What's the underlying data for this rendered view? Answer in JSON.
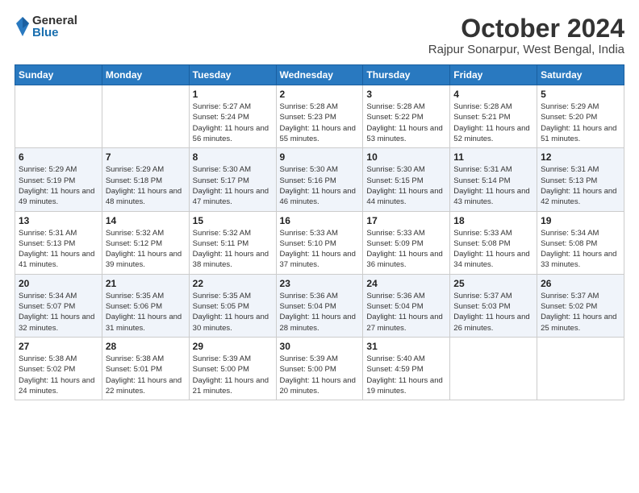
{
  "logo": {
    "general": "General",
    "blue": "Blue"
  },
  "title": "October 2024",
  "location": "Rajpur Sonarpur, West Bengal, India",
  "headers": [
    "Sunday",
    "Monday",
    "Tuesday",
    "Wednesday",
    "Thursday",
    "Friday",
    "Saturday"
  ],
  "weeks": [
    [
      {
        "day": "",
        "sunrise": "",
        "sunset": "",
        "daylight": ""
      },
      {
        "day": "",
        "sunrise": "",
        "sunset": "",
        "daylight": ""
      },
      {
        "day": "1",
        "sunrise": "Sunrise: 5:27 AM",
        "sunset": "Sunset: 5:24 PM",
        "daylight": "Daylight: 11 hours and 56 minutes."
      },
      {
        "day": "2",
        "sunrise": "Sunrise: 5:28 AM",
        "sunset": "Sunset: 5:23 PM",
        "daylight": "Daylight: 11 hours and 55 minutes."
      },
      {
        "day": "3",
        "sunrise": "Sunrise: 5:28 AM",
        "sunset": "Sunset: 5:22 PM",
        "daylight": "Daylight: 11 hours and 53 minutes."
      },
      {
        "day": "4",
        "sunrise": "Sunrise: 5:28 AM",
        "sunset": "Sunset: 5:21 PM",
        "daylight": "Daylight: 11 hours and 52 minutes."
      },
      {
        "day": "5",
        "sunrise": "Sunrise: 5:29 AM",
        "sunset": "Sunset: 5:20 PM",
        "daylight": "Daylight: 11 hours and 51 minutes."
      }
    ],
    [
      {
        "day": "6",
        "sunrise": "Sunrise: 5:29 AM",
        "sunset": "Sunset: 5:19 PM",
        "daylight": "Daylight: 11 hours and 49 minutes."
      },
      {
        "day": "7",
        "sunrise": "Sunrise: 5:29 AM",
        "sunset": "Sunset: 5:18 PM",
        "daylight": "Daylight: 11 hours and 48 minutes."
      },
      {
        "day": "8",
        "sunrise": "Sunrise: 5:30 AM",
        "sunset": "Sunset: 5:17 PM",
        "daylight": "Daylight: 11 hours and 47 minutes."
      },
      {
        "day": "9",
        "sunrise": "Sunrise: 5:30 AM",
        "sunset": "Sunset: 5:16 PM",
        "daylight": "Daylight: 11 hours and 46 minutes."
      },
      {
        "day": "10",
        "sunrise": "Sunrise: 5:30 AM",
        "sunset": "Sunset: 5:15 PM",
        "daylight": "Daylight: 11 hours and 44 minutes."
      },
      {
        "day": "11",
        "sunrise": "Sunrise: 5:31 AM",
        "sunset": "Sunset: 5:14 PM",
        "daylight": "Daylight: 11 hours and 43 minutes."
      },
      {
        "day": "12",
        "sunrise": "Sunrise: 5:31 AM",
        "sunset": "Sunset: 5:13 PM",
        "daylight": "Daylight: 11 hours and 42 minutes."
      }
    ],
    [
      {
        "day": "13",
        "sunrise": "Sunrise: 5:31 AM",
        "sunset": "Sunset: 5:13 PM",
        "daylight": "Daylight: 11 hours and 41 minutes."
      },
      {
        "day": "14",
        "sunrise": "Sunrise: 5:32 AM",
        "sunset": "Sunset: 5:12 PM",
        "daylight": "Daylight: 11 hours and 39 minutes."
      },
      {
        "day": "15",
        "sunrise": "Sunrise: 5:32 AM",
        "sunset": "Sunset: 5:11 PM",
        "daylight": "Daylight: 11 hours and 38 minutes."
      },
      {
        "day": "16",
        "sunrise": "Sunrise: 5:33 AM",
        "sunset": "Sunset: 5:10 PM",
        "daylight": "Daylight: 11 hours and 37 minutes."
      },
      {
        "day": "17",
        "sunrise": "Sunrise: 5:33 AM",
        "sunset": "Sunset: 5:09 PM",
        "daylight": "Daylight: 11 hours and 36 minutes."
      },
      {
        "day": "18",
        "sunrise": "Sunrise: 5:33 AM",
        "sunset": "Sunset: 5:08 PM",
        "daylight": "Daylight: 11 hours and 34 minutes."
      },
      {
        "day": "19",
        "sunrise": "Sunrise: 5:34 AM",
        "sunset": "Sunset: 5:08 PM",
        "daylight": "Daylight: 11 hours and 33 minutes."
      }
    ],
    [
      {
        "day": "20",
        "sunrise": "Sunrise: 5:34 AM",
        "sunset": "Sunset: 5:07 PM",
        "daylight": "Daylight: 11 hours and 32 minutes."
      },
      {
        "day": "21",
        "sunrise": "Sunrise: 5:35 AM",
        "sunset": "Sunset: 5:06 PM",
        "daylight": "Daylight: 11 hours and 31 minutes."
      },
      {
        "day": "22",
        "sunrise": "Sunrise: 5:35 AM",
        "sunset": "Sunset: 5:05 PM",
        "daylight": "Daylight: 11 hours and 30 minutes."
      },
      {
        "day": "23",
        "sunrise": "Sunrise: 5:36 AM",
        "sunset": "Sunset: 5:04 PM",
        "daylight": "Daylight: 11 hours and 28 minutes."
      },
      {
        "day": "24",
        "sunrise": "Sunrise: 5:36 AM",
        "sunset": "Sunset: 5:04 PM",
        "daylight": "Daylight: 11 hours and 27 minutes."
      },
      {
        "day": "25",
        "sunrise": "Sunrise: 5:37 AM",
        "sunset": "Sunset: 5:03 PM",
        "daylight": "Daylight: 11 hours and 26 minutes."
      },
      {
        "day": "26",
        "sunrise": "Sunrise: 5:37 AM",
        "sunset": "Sunset: 5:02 PM",
        "daylight": "Daylight: 11 hours and 25 minutes."
      }
    ],
    [
      {
        "day": "27",
        "sunrise": "Sunrise: 5:38 AM",
        "sunset": "Sunset: 5:02 PM",
        "daylight": "Daylight: 11 hours and 24 minutes."
      },
      {
        "day": "28",
        "sunrise": "Sunrise: 5:38 AM",
        "sunset": "Sunset: 5:01 PM",
        "daylight": "Daylight: 11 hours and 22 minutes."
      },
      {
        "day": "29",
        "sunrise": "Sunrise: 5:39 AM",
        "sunset": "Sunset: 5:00 PM",
        "daylight": "Daylight: 11 hours and 21 minutes."
      },
      {
        "day": "30",
        "sunrise": "Sunrise: 5:39 AM",
        "sunset": "Sunset: 5:00 PM",
        "daylight": "Daylight: 11 hours and 20 minutes."
      },
      {
        "day": "31",
        "sunrise": "Sunrise: 5:40 AM",
        "sunset": "Sunset: 4:59 PM",
        "daylight": "Daylight: 11 hours and 19 minutes."
      },
      {
        "day": "",
        "sunrise": "",
        "sunset": "",
        "daylight": ""
      },
      {
        "day": "",
        "sunrise": "",
        "sunset": "",
        "daylight": ""
      }
    ]
  ]
}
